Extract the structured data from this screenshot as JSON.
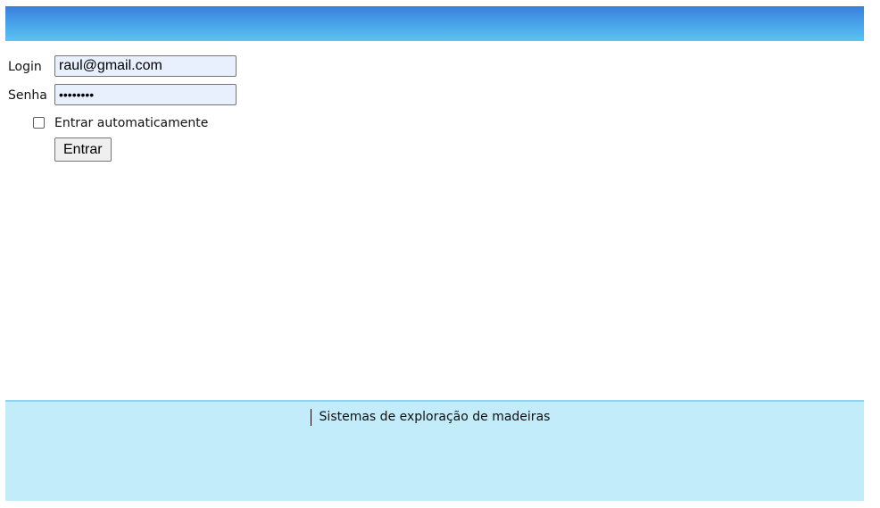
{
  "login_form": {
    "login_label": "Login",
    "login_value": "raul@gmail.com",
    "password_label": "Senha",
    "password_value": "••••••••",
    "remember_label": "Entrar automaticamente",
    "remember_checked": false,
    "submit_label": "Entrar"
  },
  "footer": {
    "text": "Sistemas de exploração de madeiras"
  },
  "colors": {
    "header_gradient_top": "#3a7fdc",
    "header_gradient_bottom": "#5cc3f1",
    "footer_background": "#c2ecfa",
    "input_autofill_background": "#e8f0fe"
  }
}
